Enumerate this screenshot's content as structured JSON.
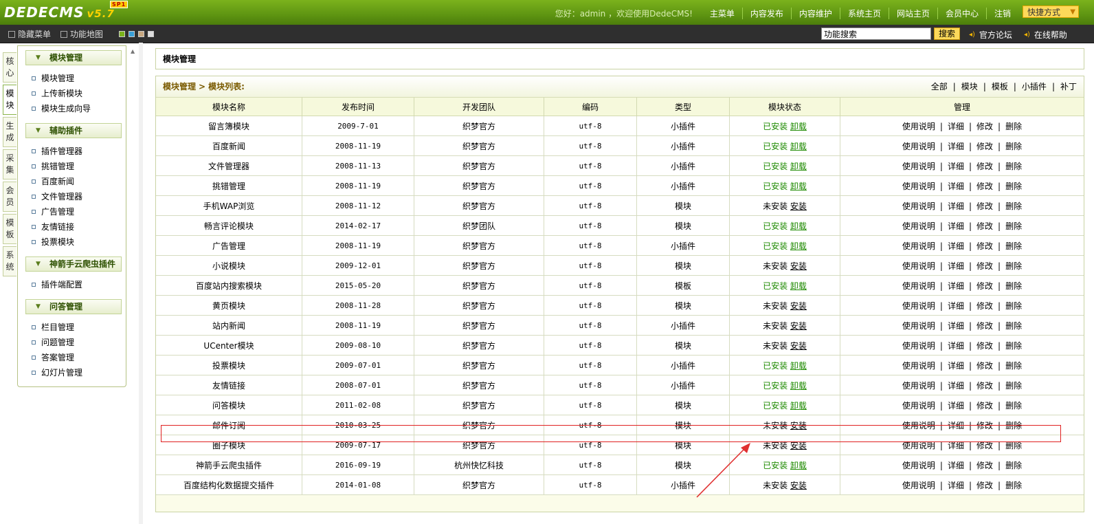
{
  "app": {
    "logo": "DEDECMS",
    "version": "v5.7",
    "edition": "SP1",
    "welcome": "您好：admin ，欢迎使用DedeCMS!",
    "nav": [
      "主菜单",
      "内容发布",
      "内容维护",
      "系统主页",
      "网站主页",
      "会员中心",
      "注销"
    ],
    "quick": "快捷方式"
  },
  "subbar": {
    "hide_menu": "隐藏菜单",
    "func_map": "功能地图",
    "search_value": "功能搜索",
    "search_btn": "搜索",
    "forum": "官方论坛",
    "help": "在线帮助"
  },
  "vtabs": [
    "核心",
    "模块",
    "生成",
    "采集",
    "会员",
    "模板",
    "系统"
  ],
  "sidebar": [
    {
      "title": "模块管理",
      "items": [
        "模块管理",
        "上传新模块",
        "模块生成向导"
      ]
    },
    {
      "title": "辅助插件",
      "items": [
        "插件管理器",
        "挑错管理",
        "百度新闻",
        "文件管理器",
        "广告管理",
        "友情链接",
        "投票模块"
      ]
    },
    {
      "title": "神箭手云爬虫插件",
      "items": [
        "插件端配置"
      ]
    },
    {
      "title": "问答管理",
      "items": [
        "栏目管理",
        "问题管理",
        "答案管理",
        "幻灯片管理"
      ]
    }
  ],
  "main": {
    "title": "模块管理",
    "breadcrumb": [
      "模块管理",
      "模块列表:"
    ],
    "filters": [
      "全部",
      "模块",
      "模板",
      "小插件",
      "补丁"
    ],
    "columns": [
      "模块名称",
      "发布时间",
      "开发团队",
      "编码",
      "类型",
      "模块状态",
      "管理"
    ],
    "ops": [
      "使用说明",
      "详细",
      "修改",
      "删除"
    ],
    "status_labels": {
      "installed": "已安装",
      "uninstalled": "未安装",
      "uninstall_action": "卸载",
      "install_action": "安装"
    },
    "rows": [
      {
        "name": "留言簿模块",
        "date": "2009-7-01",
        "team": "织梦官方",
        "enc": "utf-8",
        "type": "小插件",
        "installed": true
      },
      {
        "name": "百度新闻",
        "date": "2008-11-19",
        "team": "织梦官方",
        "enc": "utf-8",
        "type": "小插件",
        "installed": true
      },
      {
        "name": "文件管理器",
        "date": "2008-11-13",
        "team": "织梦官方",
        "enc": "utf-8",
        "type": "小插件",
        "installed": true
      },
      {
        "name": "挑错管理",
        "date": "2008-11-19",
        "team": "织梦官方",
        "enc": "utf-8",
        "type": "小插件",
        "installed": true
      },
      {
        "name": "手机WAP浏览",
        "date": "2008-11-12",
        "team": "织梦官方",
        "enc": "utf-8",
        "type": "模块",
        "installed": false
      },
      {
        "name": "畅言评论模块",
        "date": "2014-02-17",
        "team": "织梦团队",
        "enc": "utf-8",
        "type": "模块",
        "installed": true
      },
      {
        "name": "广告管理",
        "date": "2008-11-19",
        "team": "织梦官方",
        "enc": "utf-8",
        "type": "小插件",
        "installed": true
      },
      {
        "name": "小说模块",
        "date": "2009-12-01",
        "team": "织梦官方",
        "enc": "utf-8",
        "type": "模块",
        "installed": false
      },
      {
        "name": "百度站内搜索模块",
        "date": "2015-05-20",
        "team": "织梦官方",
        "enc": "utf-8",
        "type": "模板",
        "installed": true
      },
      {
        "name": "黄页模块",
        "date": "2008-11-28",
        "team": "织梦官方",
        "enc": "utf-8",
        "type": "模块",
        "installed": false
      },
      {
        "name": "站内新闻",
        "date": "2008-11-19",
        "team": "织梦官方",
        "enc": "utf-8",
        "type": "小插件",
        "installed": false
      },
      {
        "name": "UCenter模块",
        "date": "2009-08-10",
        "team": "织梦官方",
        "enc": "utf-8",
        "type": "模块",
        "installed": false
      },
      {
        "name": "投票模块",
        "date": "2009-07-01",
        "team": "织梦官方",
        "enc": "utf-8",
        "type": "小插件",
        "installed": true
      },
      {
        "name": "友情链接",
        "date": "2008-07-01",
        "team": "织梦官方",
        "enc": "utf-8",
        "type": "小插件",
        "installed": true
      },
      {
        "name": "问答模块",
        "date": "2011-02-08",
        "team": "织梦官方",
        "enc": "utf-8",
        "type": "模块",
        "installed": true
      },
      {
        "name": "邮件订阅",
        "date": "2010-03-25",
        "team": "织梦官方",
        "enc": "utf-8",
        "type": "模块",
        "installed": false
      },
      {
        "name": "圈子模块",
        "date": "2009-07-17",
        "team": "织梦官方",
        "enc": "utf-8",
        "type": "模块",
        "installed": false
      },
      {
        "name": "神箭手云爬虫插件",
        "date": "2016-09-19",
        "team": "杭州快忆科技",
        "enc": "utf-8",
        "type": "模块",
        "installed": true
      },
      {
        "name": "百度结构化数据提交插件",
        "date": "2014-01-08",
        "team": "织梦官方",
        "enc": "utf-8",
        "type": "小插件",
        "installed": false
      }
    ]
  },
  "colors": {
    "accent": "#5e9512",
    "installed": "#1e8a00",
    "highlight": "#e02020"
  }
}
